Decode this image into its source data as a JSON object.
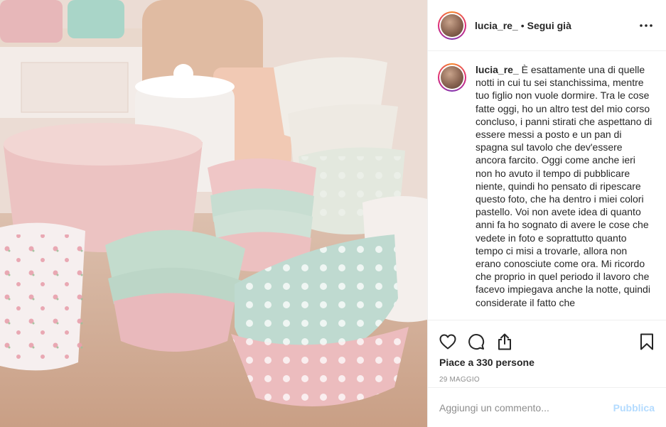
{
  "post": {
    "image_alt": "pastel kitchenware: cups, bowls and ramekins",
    "author": {
      "username": "lucia_re_",
      "separator": "•",
      "follow_label": "Segui già"
    },
    "caption": {
      "username": "lucia_re_",
      "text": " È esattamente una di quelle notti in cui tu sei stanchissima, mentre tuo figlio non vuole dormire. Tra le cose fatte oggi, ho un altro test del mio corso concluso, i panni stirati che aspettano di essere messi a posto e un pan di spagna sul tavolo che dev'essere ancora farcito. Oggi come anche ieri non ho avuto il tempo di pubblicare niente, quindi ho pensato di ripescare questo foto, che ha dentro i miei colori pastello. Voi non avete idea di quanto anni fa ho sognato di avere le cose che vedete in foto e soprattutto quanto tempo ci misi a trovarle, allora non erano conosciute come ora. Mi ricordo che proprio in quel periodo il lavoro che facevo impiegava anche la notte, quindi considerate il fatto che"
    },
    "likes_text": "Piace a 330 persone",
    "date": "29 MAGGIO",
    "comment": {
      "placeholder": "Aggiungi un commento...",
      "value": "",
      "post_label": "Pubblica"
    }
  },
  "icons": {
    "more": "more-horizontal-icon",
    "like": "heart-icon",
    "comment": "comment-icon",
    "share": "share-icon",
    "save": "bookmark-icon"
  },
  "colors": {
    "text": "#262626",
    "secondary": "#8e8e8e",
    "border": "#efefef",
    "post_disabled": "#b3dbff"
  }
}
